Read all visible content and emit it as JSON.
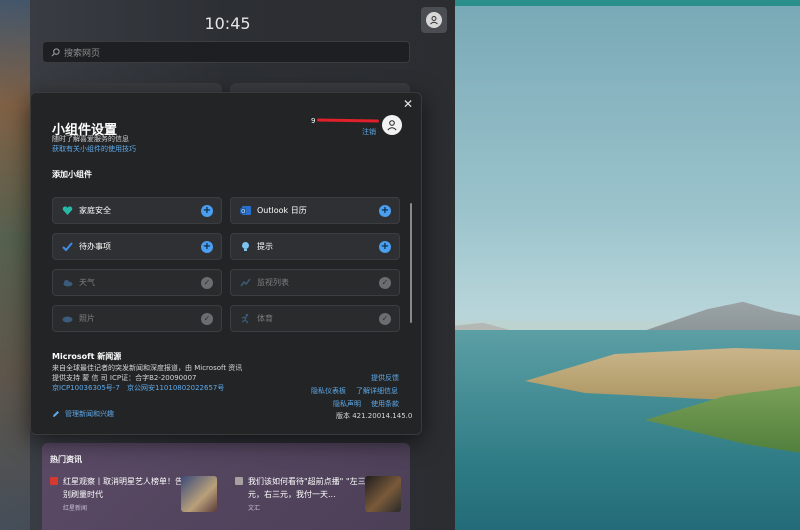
{
  "clock": {
    "time": "10:45"
  },
  "search": {
    "placeholder": "搜索网页"
  },
  "dialog": {
    "title": "小组件设置",
    "subtitle": "随时了解喜爱服务的信息",
    "tips_link": "获取有关小组件的使用技巧",
    "account": {
      "email": "9",
      "signout": "注销"
    },
    "add_header": "添加小组件",
    "widgets": [
      {
        "label": "家庭安全",
        "icon": "family-safety-icon",
        "state": "add",
        "enabled": true
      },
      {
        "label": "Outlook 日历",
        "icon": "outlook-calendar-icon",
        "state": "add",
        "enabled": true
      },
      {
        "label": "待办事项",
        "icon": "todo-icon",
        "state": "add",
        "enabled": true
      },
      {
        "label": "提示",
        "icon": "tips-icon",
        "state": "add",
        "enabled": true
      },
      {
        "label": "天气",
        "icon": "weather-icon",
        "state": "added",
        "enabled": false
      },
      {
        "label": "监视列表",
        "icon": "watchlist-icon",
        "state": "added",
        "enabled": false
      },
      {
        "label": "照片",
        "icon": "photos-icon",
        "state": "added",
        "enabled": false
      },
      {
        "label": "体育",
        "icon": "sports-icon",
        "state": "added",
        "enabled": false
      }
    ],
    "ms": {
      "title": "Microsoft 新闻源",
      "line1": "来自全球最佳记者的突发新闻和深度报道，由 Microsoft 资讯",
      "line2": "提供支持 蒙 信 司 ICP证：合字B2-20090007",
      "icp": "京ICP10036305号-7",
      "gongan": "京公网安11010802022657号",
      "feedback": "提供反馈",
      "privacy_dashboard": "隐私仪表板",
      "learn_more": "了解详细信息",
      "privacy_statement": "隐私声明",
      "terms": "使用条款",
      "version": "版本 421.20014.145.0",
      "manage": "管理新闻和兴趣"
    }
  },
  "news": {
    "title": "热门资讯",
    "items": [
      {
        "text": "红星观察丨取消明星艺人榜单！告别刷量时代",
        "source": "红星新闻"
      },
      {
        "text": "我们该如何看待\"超前点播\" \"左三元，右三元，我付一天...",
        "source": "文汇"
      }
    ]
  },
  "colors": {
    "accent": "#4a9ff0",
    "link": "#5ea9ea",
    "dialog_bg": "#232425",
    "wallpaper_bar": "#2a8f8a"
  }
}
